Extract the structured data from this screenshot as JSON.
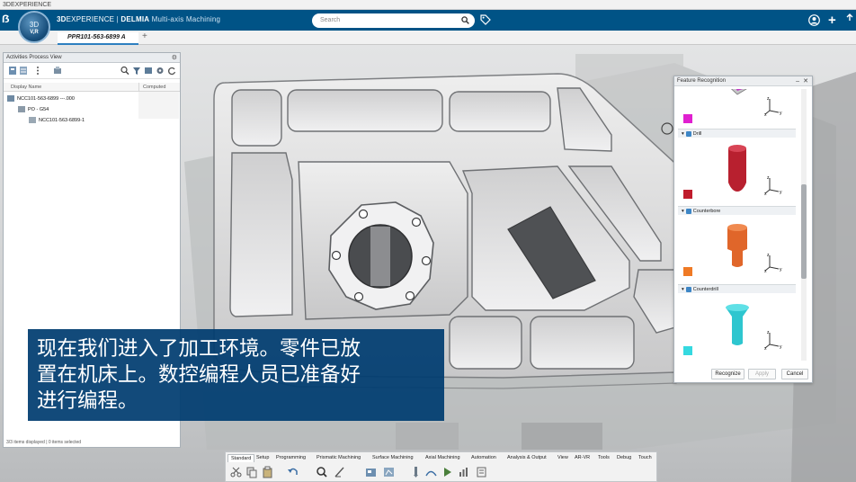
{
  "window": {
    "title": "3DEXPERIENCE"
  },
  "header": {
    "brand_3d": "3D",
    "brand_experience": "EXPERIENCE",
    "brand_app": "DELMIA",
    "brand_module": "Multi-axis Machining",
    "compass_version": "V,R",
    "search_placeholder": "Search"
  },
  "tabs": {
    "document": "PPR101-563-6899 A",
    "add": "+"
  },
  "activities_panel": {
    "title": "Activities Process View",
    "columns": [
      "Display Name",
      "Computed"
    ],
    "tree": [
      {
        "label": "NCC101-563-6899 ---.000",
        "level": 0
      },
      {
        "label": "PO - G54",
        "level": 1
      },
      {
        "label": "NCC101-563-6899-1",
        "level": 2
      }
    ],
    "status": "3/3 items displayed | 0 items selected"
  },
  "subtitle": {
    "lines": [
      "现在我们进入了加工环境。零件已放",
      "置在机床上。数控编程人员已准备好",
      "进行编程。"
    ]
  },
  "feature_recognition": {
    "title": "Feature Recognition",
    "groups": [
      {
        "label": "",
        "color": "#e020d0"
      },
      {
        "label": "Drill",
        "color": "#c01c2c"
      },
      {
        "label": "Counterbore",
        "color": "#ef7a25"
      },
      {
        "label": "Counterdrill",
        "color": "#35d9e0"
      }
    ],
    "axis_labels": {
      "x": "x",
      "y": "y",
      "z": "z"
    },
    "buttons": {
      "recognize": "Recognize",
      "apply": "Apply",
      "cancel": "Cancel"
    }
  },
  "action_bar": {
    "tabs": [
      "Standard",
      "Setup",
      "Programming",
      "Prismatic Machining",
      "Surface Machining",
      "Axial Machining",
      "Automation",
      "Analysis & Output",
      "View",
      "AR-VR",
      "Tools",
      "Debug",
      "Touch"
    ],
    "active_tab": "Standard"
  },
  "colors": {
    "topbar": "#005386",
    "subtitle_bg": "#003c70",
    "accent": "#2d7fc0"
  }
}
